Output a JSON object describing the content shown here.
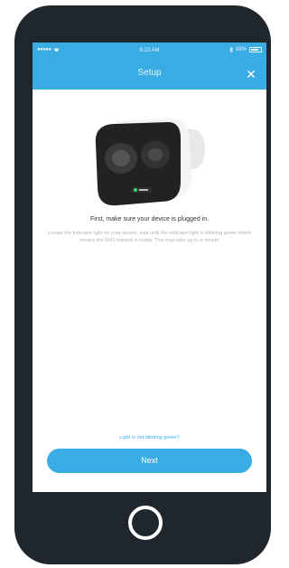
{
  "status_bar": {
    "signal": "●●●●●",
    "time": "8:23 AM",
    "battery": "88%"
  },
  "nav": {
    "title": "Setup",
    "close_glyph": "✕"
  },
  "content": {
    "headline": "First, make sure your device is plugged in.",
    "description": "Locate the indicator light on your device, wait until the indicator light is blinking green which means the WiFi hotspot is ready. This may take up to a minute",
    "help_link": "Light is not blinking green?",
    "next_label": "Next"
  },
  "colors": {
    "accent": "#3aace4",
    "phone_body": "#1f262c"
  },
  "icons": [
    "wifi-icon",
    "bluetooth-icon",
    "battery-icon",
    "close-icon",
    "camera-image",
    "home-button"
  ]
}
